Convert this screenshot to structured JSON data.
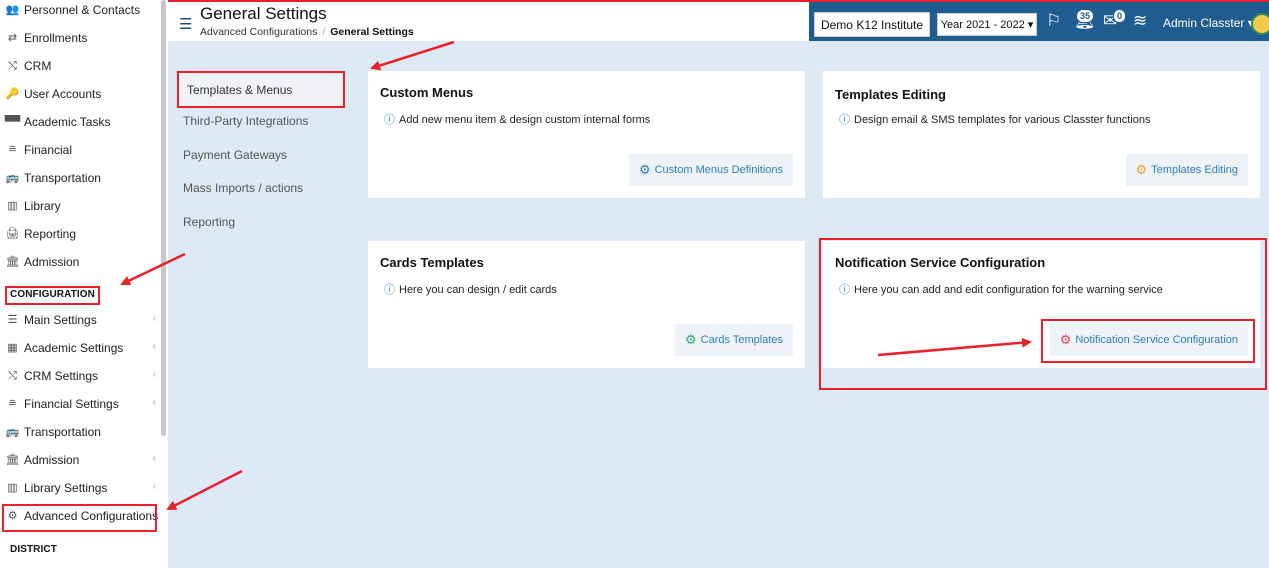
{
  "sidebar": {
    "items": [
      {
        "label": "Personnel & Contacts",
        "icon": "people-icon",
        "glyph": "👥"
      },
      {
        "label": "Enrollments",
        "icon": "transfer-icon",
        "glyph": "⇄"
      },
      {
        "label": "CRM",
        "icon": "shuffle-icon",
        "glyph": "⤭"
      },
      {
        "label": "User Accounts",
        "icon": "key-icon",
        "glyph": "🔑"
      },
      {
        "label": "Academic Tasks",
        "icon": "tasks-icon",
        "glyph": "▀▀"
      },
      {
        "label": "Financial",
        "icon": "coins-icon",
        "glyph": "≘"
      },
      {
        "label": "Transportation",
        "icon": "bus-icon",
        "glyph": "🚌"
      },
      {
        "label": "Library",
        "icon": "books-icon",
        "glyph": "▥"
      },
      {
        "label": "Reporting",
        "icon": "printer-icon",
        "glyph": "🖨"
      },
      {
        "label": "Admission",
        "icon": "institution-icon",
        "glyph": "🏛"
      }
    ],
    "config_heading": "CONFIGURATION",
    "config_items": [
      {
        "label": "Main Settings",
        "icon": "sliders-icon",
        "glyph": "☰"
      },
      {
        "label": "Academic Settings",
        "icon": "classroom-icon",
        "glyph": "▦"
      },
      {
        "label": "CRM Settings",
        "icon": "shuffle-icon",
        "glyph": "⤭"
      },
      {
        "label": "Financial Settings",
        "icon": "coins-icon",
        "glyph": "≘"
      },
      {
        "label": "Transportation",
        "icon": "bus-icon",
        "glyph": "🚌"
      },
      {
        "label": "Admission",
        "icon": "institution-icon",
        "glyph": "🏛"
      },
      {
        "label": "Library Settings",
        "icon": "books-icon",
        "glyph": "▥"
      },
      {
        "label": "Advanced Configurations",
        "icon": "gears-icon",
        "glyph": "⚙"
      }
    ],
    "district_heading": "DISTRICT"
  },
  "header": {
    "title": "General Settings",
    "breadcrumb_parent": "Advanced Configurations",
    "breadcrumb_sep": "/",
    "breadcrumb_current": "General Settings",
    "institution": "Demo K12 Institute",
    "year": "Year 2021 - 2022",
    "year_caret": "▾",
    "notifications_count": "35",
    "messages_count": "0",
    "user_name": "Admin Classter",
    "user_caret": "▾"
  },
  "subnav": {
    "active": "Templates & Menus",
    "items": [
      "Third-Party Integrations",
      "Payment Gateways",
      "Mass Imports / actions",
      "Reporting"
    ]
  },
  "cards": [
    {
      "title": "Custom Menus",
      "desc": "Add new menu item & design custom internal forms",
      "button": "Custom Menus Definitions",
      "gear_color": "#2f7fbf"
    },
    {
      "title": "Templates Editing",
      "desc": "Design email & SMS templates for various Classter functions",
      "button": "Templates Editing",
      "gear_color": "#f0a030"
    },
    {
      "title": "Cards Templates",
      "desc": "Here you can design / edit cards",
      "button": "Cards Templates",
      "gear_color": "#2ea86b"
    },
    {
      "title": "Notification Service Configuration",
      "desc": "Here you can add and edit configuration for the warning service",
      "button": "Notification Service Configuration",
      "gear_color": "#e8485a"
    }
  ],
  "colors": {
    "accent": "#e8212b",
    "header_blue": "#1f5d91",
    "content_bg": "#ddeaf6",
    "link_blue": "#2f7fbf"
  }
}
